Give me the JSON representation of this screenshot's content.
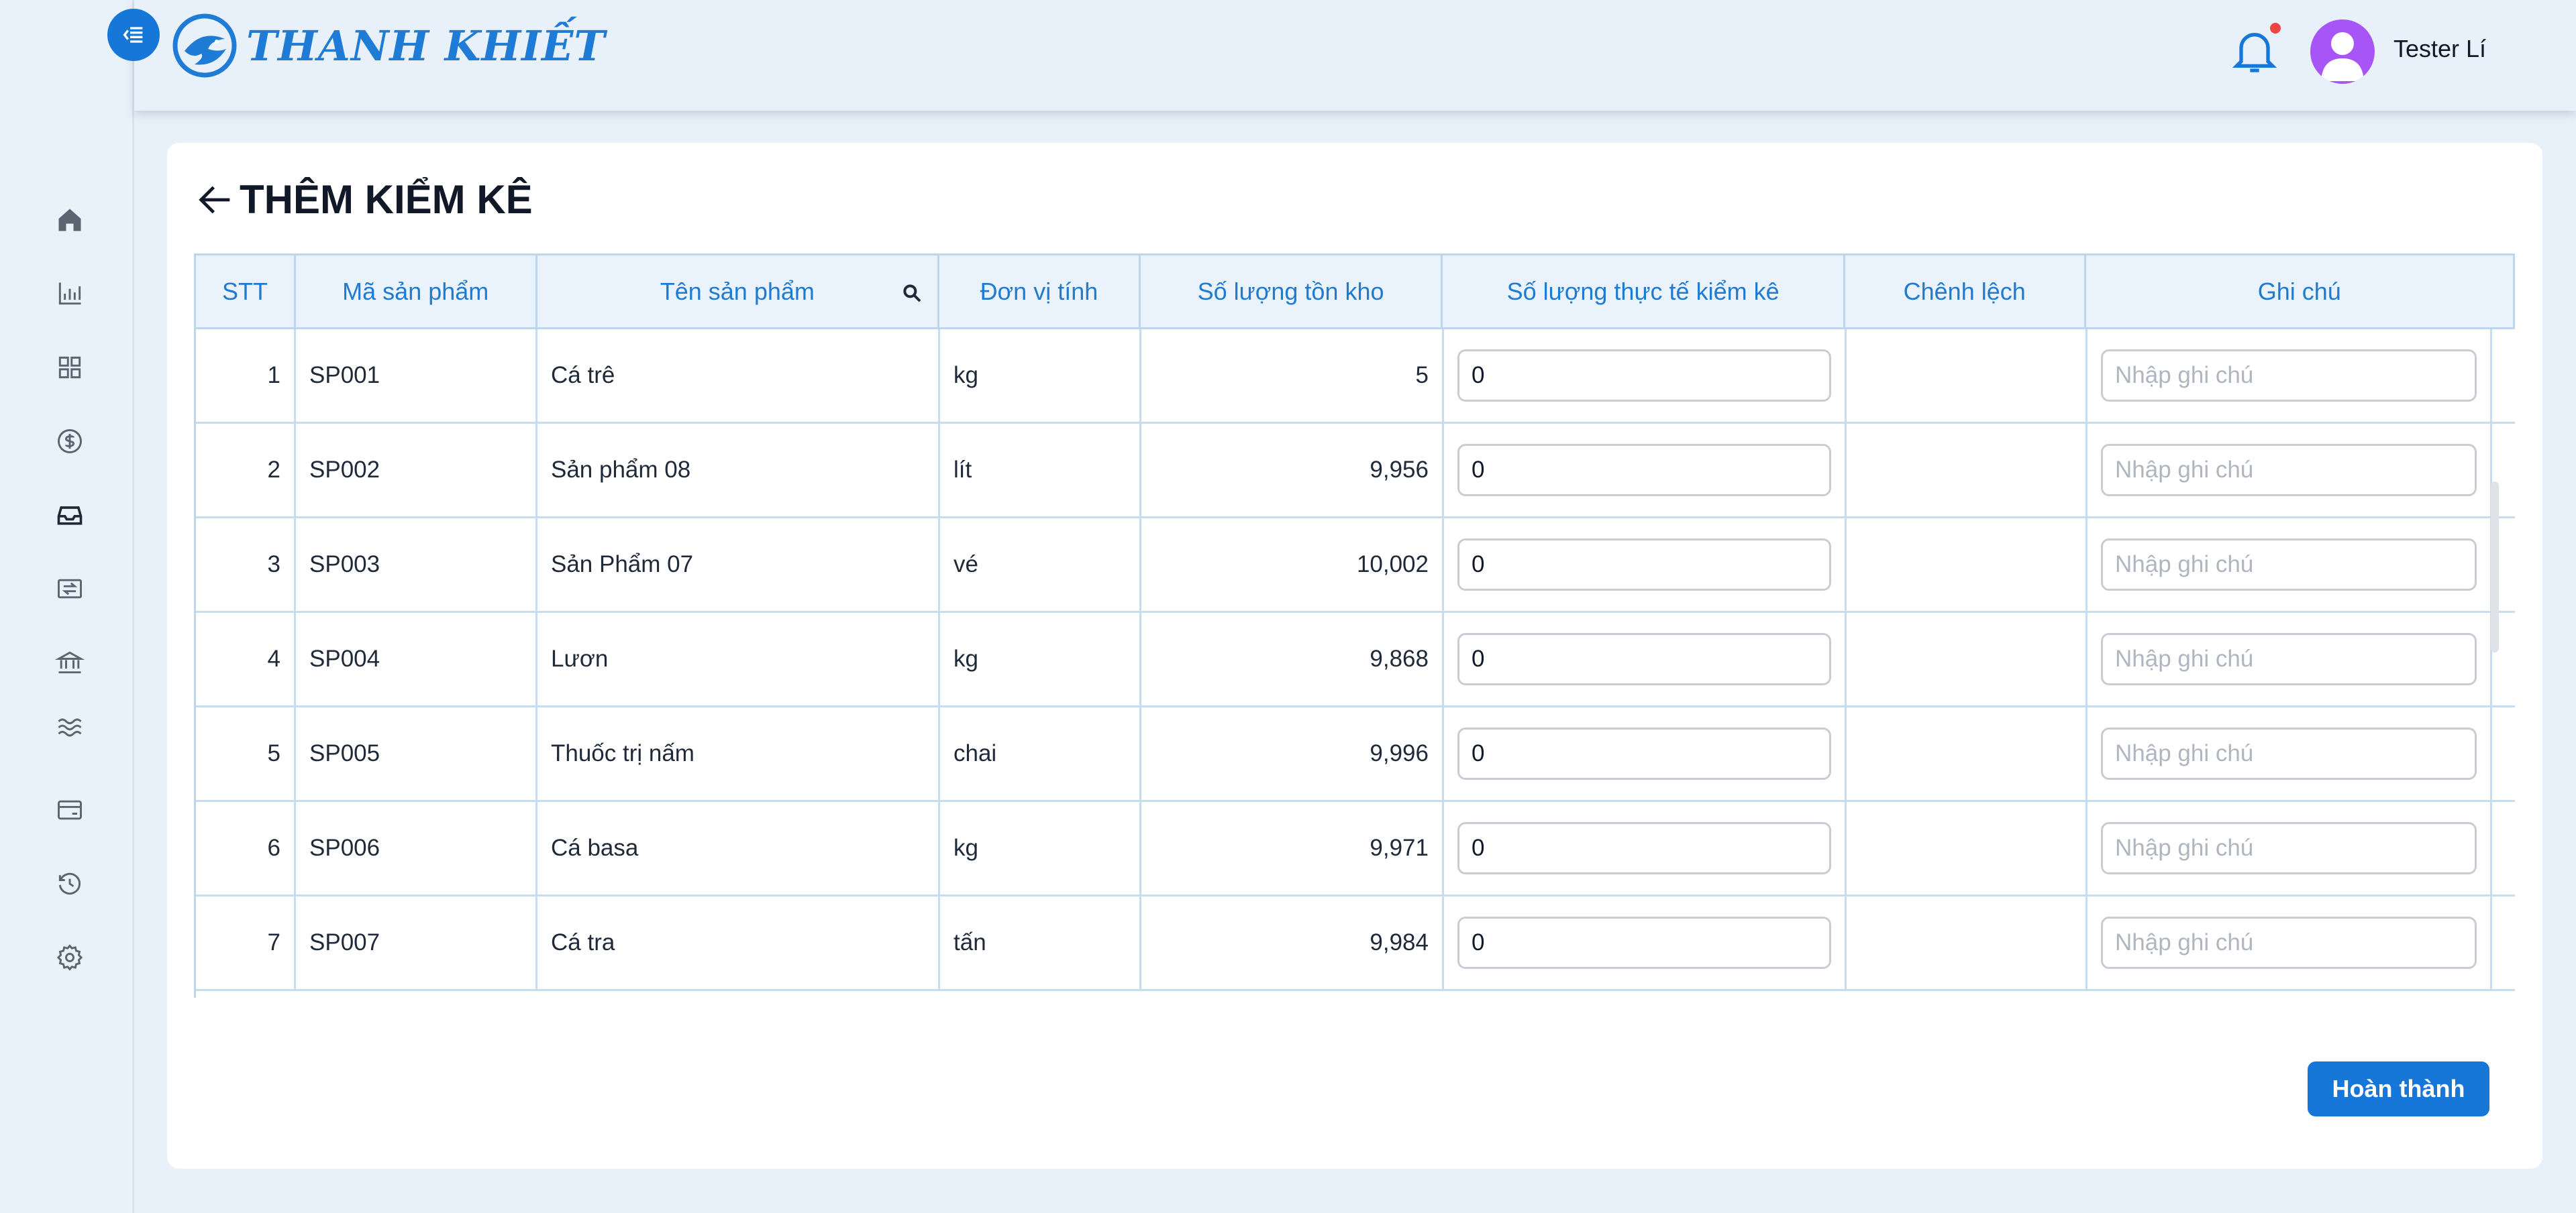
{
  "app": {
    "brand": "THANH KHIẾT",
    "user_name": "Tester Lí",
    "accent_color": "#1677d9"
  },
  "sidebar": {
    "items": [
      {
        "icon": "home-icon"
      },
      {
        "icon": "bar-chart-icon"
      },
      {
        "icon": "grid-icon"
      },
      {
        "icon": "dollar-circle-icon"
      },
      {
        "icon": "inbox-icon"
      },
      {
        "icon": "transfer-icon"
      },
      {
        "icon": "bank-icon"
      },
      {
        "icon": "waves-icon"
      },
      {
        "icon": "credit-card-icon"
      },
      {
        "icon": "history-icon"
      },
      {
        "icon": "settings-icon"
      }
    ]
  },
  "page": {
    "title": "THÊM KIỂM KÊ",
    "submit_label": "Hoàn thành"
  },
  "table": {
    "columns": [
      "STT",
      "Mã sản phẩm",
      "Tên sản phẩm",
      "Đơn vị tính",
      "Số lượng tồn kho",
      "Số lượng thực tế kiểm kê",
      "Chênh lệch",
      "Ghi chú"
    ],
    "note_placeholder": "Nhập ghi chú",
    "rows": [
      {
        "stt": "1",
        "code": "SP001",
        "name": "Cá trê",
        "unit": "kg",
        "stock": "5",
        "actual": "0",
        "diff": ""
      },
      {
        "stt": "2",
        "code": "SP002",
        "name": "Sản phẩm 08",
        "unit": "lít",
        "stock": "9,956",
        "actual": "0",
        "diff": ""
      },
      {
        "stt": "3",
        "code": "SP003",
        "name": "Sản Phẩm 07",
        "unit": "vé",
        "stock": "10,002",
        "actual": "0",
        "diff": ""
      },
      {
        "stt": "4",
        "code": "SP004",
        "name": "Lươn",
        "unit": "kg",
        "stock": "9,868",
        "actual": "0",
        "diff": ""
      },
      {
        "stt": "5",
        "code": "SP005",
        "name": "Thuốc trị nấm",
        "unit": "chai",
        "stock": "9,996",
        "actual": "0",
        "diff": ""
      },
      {
        "stt": "6",
        "code": "SP006",
        "name": "Cá basa",
        "unit": "kg",
        "stock": "9,971",
        "actual": "0",
        "diff": ""
      },
      {
        "stt": "7",
        "code": "SP007",
        "name": "Cá tra",
        "unit": "tấn",
        "stock": "9,984",
        "actual": "0",
        "diff": ""
      }
    ]
  }
}
